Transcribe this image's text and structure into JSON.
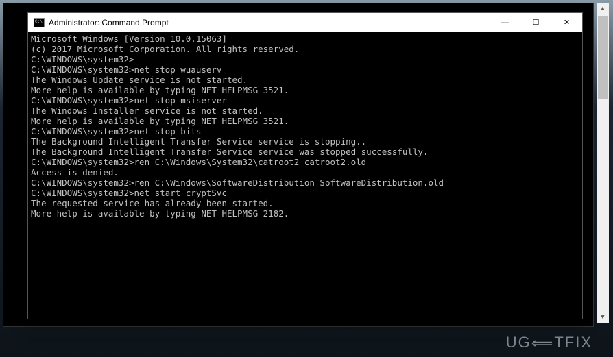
{
  "window": {
    "title": "Administrator: Command Prompt",
    "controls": {
      "minimize": "—",
      "maximize": "☐",
      "close": "✕"
    }
  },
  "terminal": {
    "lines": [
      "Microsoft Windows [Version 10.0.15063]",
      "(c) 2017 Microsoft Corporation. All rights reserved.",
      "",
      "C:\\WINDOWS\\system32>",
      "C:\\WINDOWS\\system32>net stop wuauserv",
      "The Windows Update service is not started.",
      "",
      "More help is available by typing NET HELPMSG 3521.",
      "",
      "",
      "C:\\WINDOWS\\system32>net stop msiserver",
      "The Windows Installer service is not started.",
      "",
      "More help is available by typing NET HELPMSG 3521.",
      "",
      "",
      "C:\\WINDOWS\\system32>net stop bits",
      "The Background Intelligent Transfer Service service is stopping..",
      "The Background Intelligent Transfer Service service was stopped successfully.",
      "",
      "",
      "C:\\WINDOWS\\system32>ren C:\\Windows\\System32\\catroot2 catroot2.old",
      "Access is denied.",
      "",
      "C:\\WINDOWS\\system32>ren C:\\Windows\\SoftwareDistribution SoftwareDistribution.old",
      "",
      "C:\\WINDOWS\\system32>net start cryptSvc",
      "The requested service has already been started.",
      "",
      "More help is available by typing NET HELPMSG 2182."
    ]
  },
  "scrollbar": {
    "arrow_up": "▲",
    "arrow_down": "▼"
  },
  "watermark": {
    "text_pre": "UG",
    "arrow": "⟸",
    "text_post": "TFIX"
  }
}
